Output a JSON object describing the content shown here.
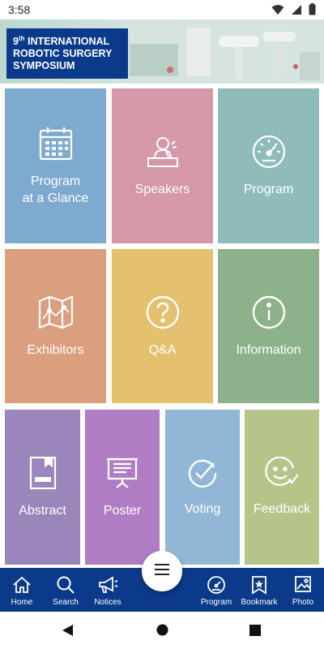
{
  "status_bar": {
    "time": "3:58"
  },
  "banner": {
    "title_line1_prefix": "9",
    "title_line1_sup": "th",
    "title_line1_rest": " INTERNATIONAL",
    "title_line2": "ROBOTIC SURGERY",
    "title_line3": "SYMPOSIUM"
  },
  "tiles": [
    {
      "label": "Program\nat a Glance",
      "icon": "calendar-icon",
      "color": "#7faacf"
    },
    {
      "label": "Speakers",
      "icon": "speaker-podium-icon",
      "color": "#d498a8"
    },
    {
      "label": "Program",
      "icon": "clock-dial-icon",
      "color": "#8fbcba"
    },
    {
      "label": "Exhibitors",
      "icon": "map-icon",
      "color": "#db9f7f"
    },
    {
      "label": "Q&A",
      "icon": "question-circle-icon",
      "color": "#e4c06f"
    },
    {
      "label": "Information",
      "icon": "info-circle-icon",
      "color": "#8db18a"
    },
    {
      "label": "Abstract",
      "icon": "document-bookmark-icon",
      "color": "#9a86ba"
    },
    {
      "label": "Poster",
      "icon": "presentation-board-icon",
      "color": "#b07cc3"
    },
    {
      "label": "Voting",
      "icon": "check-circle-icon",
      "color": "#91b6d6"
    },
    {
      "label": "Feedback",
      "icon": "smiley-check-icon",
      "color": "#b6c48a"
    }
  ],
  "bottom_nav": {
    "items": [
      {
        "label": "Home",
        "icon": "home-icon"
      },
      {
        "label": "Search",
        "icon": "search-icon"
      },
      {
        "label": "Notices",
        "icon": "megaphone-icon"
      },
      {
        "label": "Program",
        "icon": "clock-dial-icon"
      },
      {
        "label": "Bookmark",
        "icon": "bookmark-star-icon"
      },
      {
        "label": "Photo",
        "icon": "photo-icon"
      }
    ],
    "color": "#0b3a8a"
  },
  "fab": {
    "icon": "menu-icon"
  }
}
